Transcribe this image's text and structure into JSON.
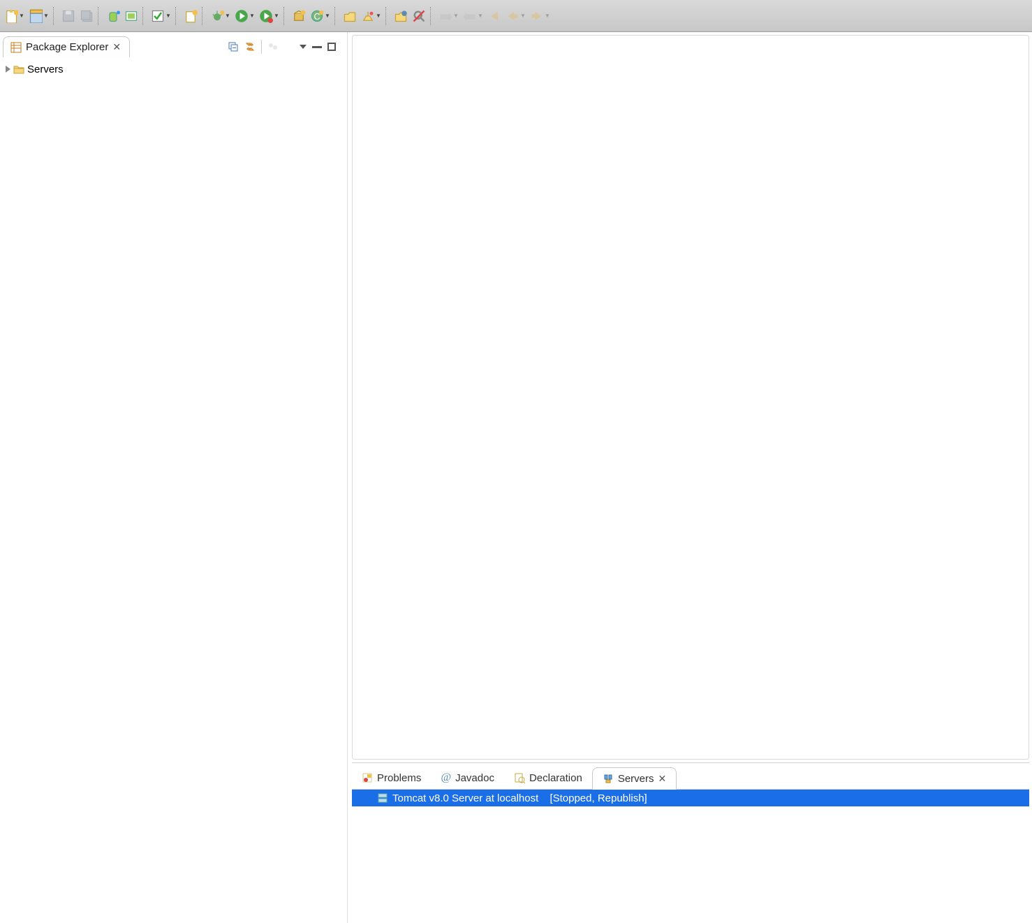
{
  "toolbar": {
    "buttons": [
      {
        "name": "new-icon",
        "dd": true
      },
      {
        "name": "save-icon",
        "dd": true
      },
      {
        "sep": true
      },
      {
        "name": "save-single-icon",
        "faded": true
      },
      {
        "name": "save-all-icon",
        "faded": true
      },
      {
        "sep": true
      },
      {
        "name": "android-sdk-icon"
      },
      {
        "name": "android-avd-icon"
      },
      {
        "sep": true
      },
      {
        "name": "checkbox-icon",
        "dd": true
      },
      {
        "sep": true
      },
      {
        "name": "new-server-icon"
      },
      {
        "sep": true
      },
      {
        "name": "debug-icon",
        "dd": true
      },
      {
        "name": "run-icon",
        "dd": true
      },
      {
        "name": "run-last-icon",
        "dd": true
      },
      {
        "sep": true
      },
      {
        "name": "new-package-icon"
      },
      {
        "name": "new-class-icon",
        "dd": true
      },
      {
        "sep": true
      },
      {
        "name": "open-type-icon"
      },
      {
        "name": "search-icon",
        "dd": true
      },
      {
        "sep": true
      },
      {
        "name": "open-task-icon"
      },
      {
        "name": "no-search-icon"
      },
      {
        "sep": true
      },
      {
        "name": "nav-icon",
        "faded": true,
        "dd": true
      },
      {
        "name": "nav2-icon",
        "faded": true,
        "dd": true
      },
      {
        "name": "back-short-icon",
        "faded": true
      },
      {
        "name": "back-icon",
        "faded": true,
        "dd": true
      },
      {
        "name": "forward-icon",
        "faded": true,
        "dd": true
      }
    ]
  },
  "packageExplorer": {
    "title": "Package Explorer",
    "items": [
      {
        "label": "Servers"
      }
    ]
  },
  "bottomTabs": {
    "problems": "Problems",
    "javadoc": "Javadoc",
    "declaration": "Declaration",
    "servers": "Servers"
  },
  "servers": {
    "rows": [
      {
        "name": "Tomcat v8.0 Server at localhost",
        "status": "[Stopped, Republish]"
      }
    ]
  }
}
